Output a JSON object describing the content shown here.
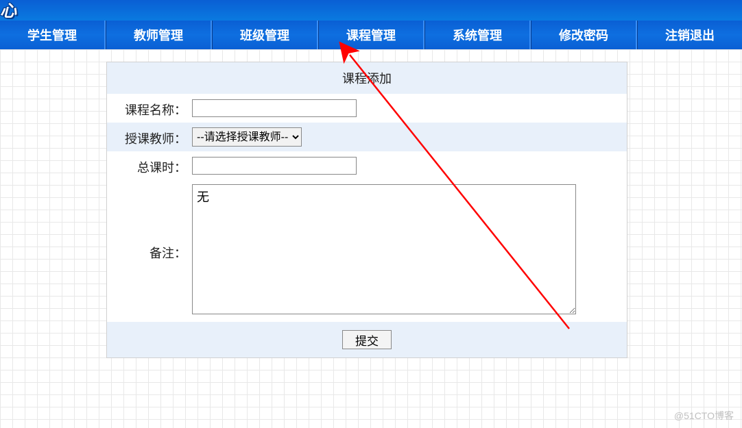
{
  "nav": {
    "items": [
      {
        "label": "学生管理"
      },
      {
        "label": "教师管理"
      },
      {
        "label": "班级管理"
      },
      {
        "label": "课程管理"
      },
      {
        "label": "系统管理"
      },
      {
        "label": "修改密码"
      },
      {
        "label": "注销退出"
      }
    ]
  },
  "form": {
    "title": "课程添加",
    "course_name_label": "课程名称：",
    "course_name_value": "",
    "teacher_label": "授课教师：",
    "teacher_selected": "--请选择授课教师--",
    "hours_label": "总课时：",
    "hours_value": "",
    "remark_label": "备注：",
    "remark_value": "无",
    "submit_label": "提交"
  },
  "watermark": "@51CTO博客"
}
